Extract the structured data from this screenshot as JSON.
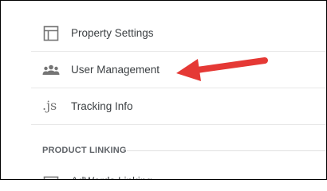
{
  "nav": {
    "items": [
      {
        "label": "Property Settings",
        "icon": "property-settings-icon"
      },
      {
        "label": "User Management",
        "icon": "users-icon"
      },
      {
        "label": "Tracking Info",
        "icon": "js-icon",
        "glyph": ".js"
      }
    ]
  },
  "product_linking": {
    "heading": "PRODUCT LINKING",
    "items": [
      {
        "label": "AdWords Linking",
        "icon": "adwords-icon"
      }
    ]
  },
  "annotation": {
    "arrow_color": "#e53935"
  },
  "colors": {
    "text": "#3c4043",
    "icon": "#757575",
    "divider": "#e8e8e8"
  }
}
